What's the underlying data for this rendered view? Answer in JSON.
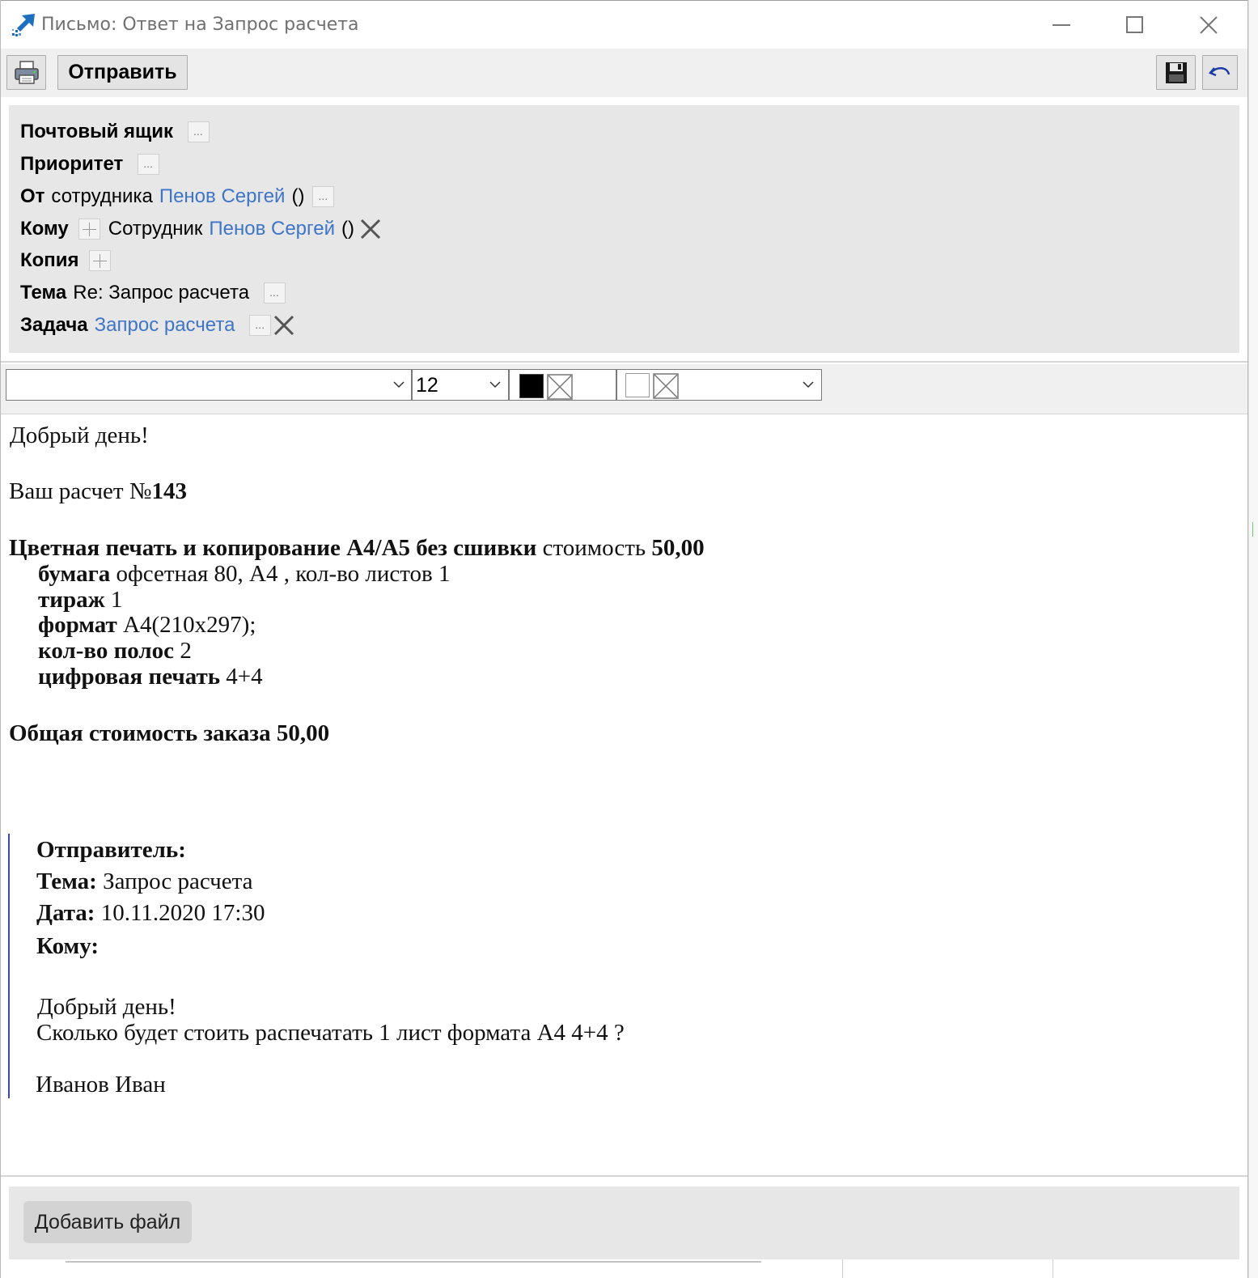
{
  "window": {
    "title": "Письмо: Ответ на Запрос расчета"
  },
  "toolbar": {
    "print_icon": "printer-icon",
    "send_label": "Отправить",
    "save_icon": "floppy-disk-icon",
    "undo_icon": "undo-arrow-icon"
  },
  "header": {
    "mailbox_label": "Почтовый ящик",
    "priority_label": "Приоритет",
    "from_label": "От",
    "from_kind": "сотрудника",
    "from_name": "Пенов Сергей",
    "from_extra": "()",
    "to_label": "Кому",
    "to_kind": "Сотрудник",
    "to_name": "Пенов Сергей",
    "to_extra": "()",
    "cc_label": "Копия",
    "subject_label": "Тема",
    "subject_value": "Re: Запрос расчета",
    "task_label": "Задача",
    "task_value": "Запрос расчета"
  },
  "format_bar": {
    "font_value": "",
    "size_value": "12",
    "text_color": "#000000"
  },
  "body": {
    "greeting": "Добрый день!",
    "calc_prefix": "Ваш расчет №",
    "calc_number": "143",
    "item_title": "Цветная печать и копирование А4/А5 без сшивки",
    "item_cost_label": "стоимость",
    "item_cost": "50,00",
    "paper_label": "бумага",
    "paper_value": "офсетная 80, А4 , кол-во листов 1",
    "run_label": "тираж",
    "run_value": "1",
    "format_label": "формат",
    "format_value": "А4(210х297);",
    "pages_label": "кол-во полос",
    "pages_value": "2",
    "print_label": "цифровая печать",
    "print_value": "4+4",
    "total": "Общая стоимость заказа 50,00"
  },
  "quote": {
    "sender_label": "Отправитель:",
    "subject_label": "Тема:",
    "subject_value": "Запрос расчета",
    "date_label": "Дата:",
    "date_value": "10.11.2020 17:30",
    "to_label": "Кому:",
    "line1": "Добрый день!",
    "line2": "Сколько будет стоить распечатать 1 лист формата А4 4+4 ?",
    "signature": "Иванов Иван"
  },
  "footer": {
    "add_file_label": "Добавить файл"
  }
}
